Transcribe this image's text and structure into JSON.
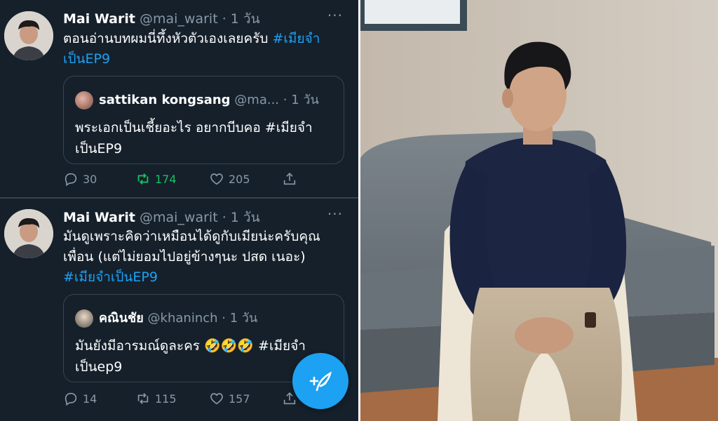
{
  "tweets": [
    {
      "name": "Mai Warit",
      "handle": "@mai_warit",
      "time": "· 1 วัน",
      "more": "···",
      "text_line1": "ตอนอ่านบทผมนี่ทึ้งหัวตัวเองเลยครับ ",
      "hashtag_inline": "#เมียจำ",
      "text_line2": "เป็นEP9",
      "quote": {
        "name": "sattikan kongsang",
        "handle": "@ma...",
        "time": "· 1 วัน",
        "line1_text": "พระเอกเป็นเชี้ยอะไร อยากบีบคอ ",
        "line1_hash": "#เมียจำ",
        "line2": "เป็นEP9"
      },
      "stats": {
        "replies": "30",
        "retweets": "174",
        "likes": "205"
      }
    },
    {
      "name": "Mai Warit",
      "handle": "@mai_warit",
      "time": "· 1 วัน",
      "more": "···",
      "text_line1": "มันดูเพราะคิดว่าเหมือนได้ดูกับเมียน่ะครับคุณ",
      "text_line2": "เพื่อน (แต่ไม่ยอมไปอยู่ข้างๆนะ ปสด เนอะ)",
      "hashtag_line3": "#เมียจำเป็นEP9",
      "quote": {
        "name": "คณินชัย",
        "handle": "@khaninch",
        "time": "· 1 วัน",
        "line1_text": "มันยังมีอารมณ์ดูละคร 🤣🤣🤣 ",
        "line1_hash": "#เมียจำ",
        "line2": "เป็นep9"
      },
      "stats": {
        "replies": "14",
        "retweets": "115",
        "likes": "157"
      }
    }
  ],
  "colors": {
    "background": "#15202b",
    "accent": "#1da1f2",
    "retweet_active": "#17bf63",
    "muted": "#8899a6"
  },
  "icons": [
    "reply-icon",
    "retweet-icon",
    "like-icon",
    "share-icon",
    "compose-tweet-icon",
    "more-icon"
  ]
}
